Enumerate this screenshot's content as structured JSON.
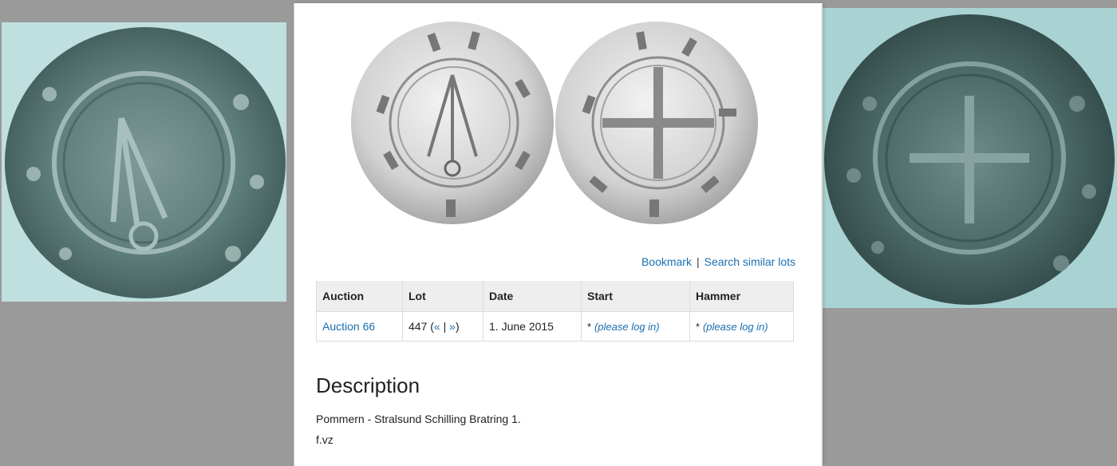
{
  "left_photo": {
    "icon": "coin-photo-obverse"
  },
  "right_photo": {
    "icon": "coin-photo-reverse"
  },
  "coin_images": {
    "obverse_icon": "coin-obverse",
    "reverse_icon": "coin-reverse"
  },
  "actions": {
    "bookmark": "Bookmark",
    "separator": "|",
    "search_similar": "Search similar lots"
  },
  "table": {
    "headers": [
      "Auction",
      "Lot",
      "Date",
      "Start",
      "Hammer"
    ],
    "row": {
      "auction": "Auction 66",
      "lot_number": "447",
      "lot_open": "(",
      "lot_prev": "«",
      "lot_sep": "|",
      "lot_next": "»",
      "lot_close": ")",
      "date": "1. June 2015",
      "start_prefix": "*",
      "start_login": "(please log in)",
      "hammer_prefix": "*",
      "hammer_login": "(please log in)"
    }
  },
  "description": {
    "title": "Description",
    "line1": "Pommern - Stralsund Schilling Bratring 1.",
    "line2": "f.vz"
  },
  "colors": {
    "link": "#1a6fb0",
    "header_bg": "#eeeeee",
    "background": "#9a9a9a"
  }
}
